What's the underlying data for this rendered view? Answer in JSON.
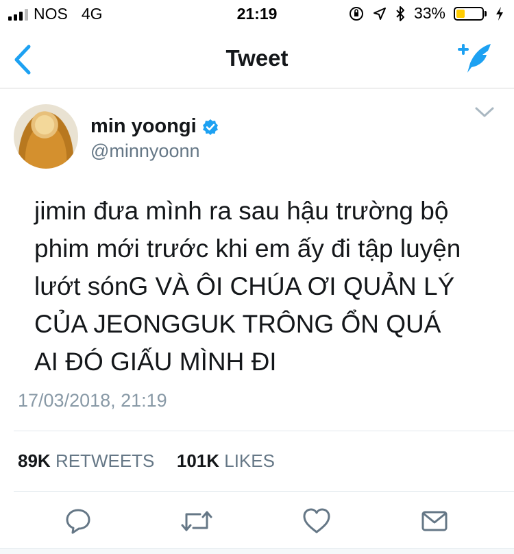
{
  "status_bar": {
    "carrier": "NOS",
    "network": "4G",
    "time": "21:19",
    "battery_percent": "33%",
    "battery_level": 0.33,
    "battery_color": "#ffcc00"
  },
  "nav": {
    "title": "Tweet"
  },
  "tweet": {
    "display_name": "min yoongi",
    "handle": "@minnyoonn",
    "text_lines": [
      "jimin đưa mình ra sau hậu trường bộ",
      "phim mới trước khi em ấy đi tập luyện",
      "lướt sónG VÀ ÔI CHÚA ƠI QUẢN LÝ",
      "CỦA JEONGGUK TRÔNG ỔN QUÁ",
      "AI ĐÓ GIẤU MÌNH ĐI"
    ],
    "timestamp": "17/03/2018, 21:19",
    "retweets_count": "89K",
    "retweets_label": "RETWEETS",
    "likes_count": "101K",
    "likes_label": "LIKES"
  },
  "icons": {
    "back": "chevron-left-icon",
    "compose": "compose-tweet-icon",
    "verified": "verified-badge-icon",
    "more": "chevron-down-icon",
    "reply": "reply-icon",
    "retweet": "retweet-icon",
    "like": "heart-icon",
    "message": "envelope-icon"
  },
  "colors": {
    "accent": "#1da1f2",
    "secondary_text": "#657786",
    "icon_gray": "#657786"
  }
}
